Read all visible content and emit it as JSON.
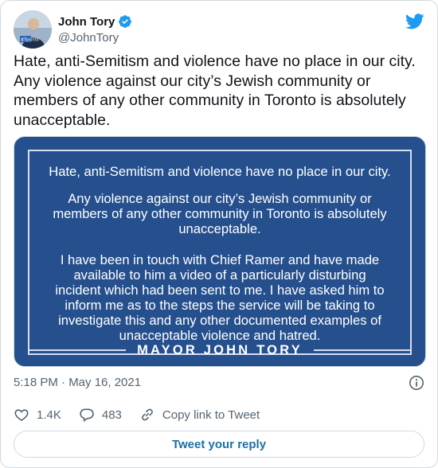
{
  "author": {
    "display_name": "John Tory",
    "handle": "@JohnTory",
    "verified": true,
    "avatar_icon": "user-avatar"
  },
  "brand": {
    "icon": "twitter-bird-icon",
    "color": "#1d9bf0"
  },
  "tweet": {
    "text_lines": [
      "Hate, anti-Semitism and violence have no place in our city.",
      "Any violence against our city’s Jewish community or",
      "members of any other community in Toronto is absolutely",
      "unacceptable."
    ]
  },
  "media": {
    "background_color": "#25508d",
    "lines": [
      "Hate, anti-Semitism and violence have no place in our city.",
      "Any violence against our city’s Jewish community or",
      "members of any other community in Toronto is absolutely",
      "unacceptable.",
      "I have been in touch with Chief Ramer and have made",
      "available to him a video of a particularly disturbing",
      "incident which had been sent to me. I have asked him to",
      "inform me as to the steps the service will be taking to",
      "investigate this and any other documented examples of",
      "unacceptable violence and hatred."
    ],
    "signature": "MAYOR JOHN TORY"
  },
  "meta": {
    "timestamp": "5:18 PM · May 16, 2021",
    "info_icon": "info-icon"
  },
  "actions": {
    "likes": "1.4K",
    "replies": "483",
    "copy_link": "Copy link to Tweet"
  },
  "reply_button": "Tweet your reply"
}
